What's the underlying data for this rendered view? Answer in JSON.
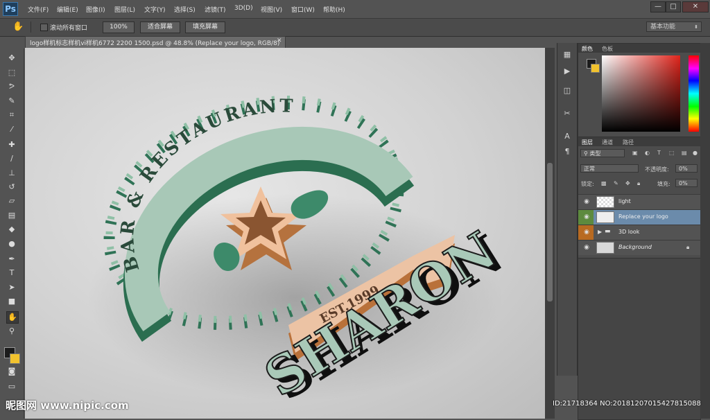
{
  "app": {
    "logo": "Ps"
  },
  "menu": [
    "文件(F)",
    "编辑(E)",
    "图像(I)",
    "图层(L)",
    "文字(Y)",
    "选择(S)",
    "滤镜(T)",
    "3D(D)",
    "视图(V)",
    "窗口(W)",
    "帮助(H)"
  ],
  "window_controls": {
    "minimize": "—",
    "maximize": "□",
    "close": "✕"
  },
  "options": {
    "scroll_all_label": "滚动所有窗口",
    "zoom_label": "100%",
    "fit_screen_label": "适合屏幕",
    "fill_screen_label": "填充屏幕",
    "workspace": "基本功能"
  },
  "document": {
    "tab_title": "logo样机标志样机vi样机6772 2200 1500.psd @ 48.8% (Replace your logo, RGB/8)",
    "close": "✕"
  },
  "logo_art": {
    "arc_text": "BAR & RESTAURANT",
    "name": "SHARON",
    "ribbon_text": "EST.1999",
    "colors": {
      "green": "#3d8a6a",
      "light_green": "#a9c9b8",
      "orange": "#e2a473",
      "black": "#1c1c1c"
    }
  },
  "color_panel": {
    "tabs": [
      "颜色",
      "色板"
    ],
    "fg": "#1c1c1c",
    "bg": "#f1c22e"
  },
  "layers_panel": {
    "tabs": [
      "图层",
      "通道",
      "路径"
    ],
    "filter_kind": "类型",
    "blend_mode": "正常",
    "opacity_label": "不透明度:",
    "opacity_value": "0%",
    "lock_label": "锁定:",
    "fill_label": "填充:",
    "fill_value": "0%",
    "layers": [
      {
        "name": "light",
        "selected": false,
        "kind": "layer"
      },
      {
        "name": "Replace your logo",
        "selected": true,
        "kind": "smart"
      },
      {
        "name": "3D look",
        "selected": false,
        "kind": "group"
      },
      {
        "name": "Background",
        "selected": false,
        "kind": "background"
      }
    ]
  },
  "watermark": {
    "left": "昵图网 www.nipic.com",
    "right": "ID:21718364 NO:20181207015427815088"
  }
}
